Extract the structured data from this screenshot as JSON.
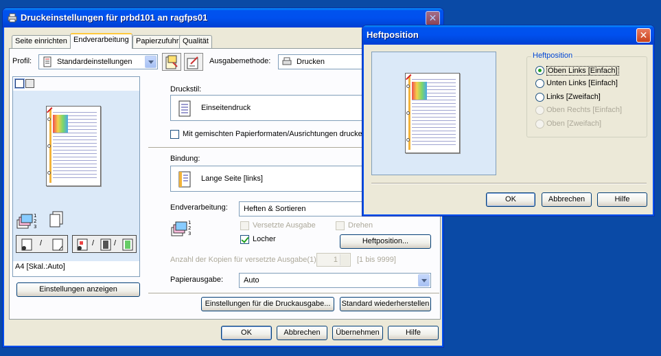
{
  "main_window": {
    "title": "Druckeinstellungen für prbd101 an ragfps01",
    "close_glyph": "✕",
    "tabs": [
      {
        "label": "Seite einrichten",
        "active": false
      },
      {
        "label": "Endverarbeitung",
        "active": true
      },
      {
        "label": "Papierzufuhr",
        "active": false
      },
      {
        "label": "Qualität",
        "active": false
      }
    ],
    "profile": {
      "label": "Profil:",
      "value": "Standardeinstellungen"
    },
    "output_method": {
      "label": "Ausgabemethode:",
      "value": "Drucken"
    },
    "preview": {
      "paper_label": "A4 [Skal.:Auto]",
      "show_settings_button": "Einstellungen anzeigen"
    },
    "print_style": {
      "label": "Druckstil:",
      "value": "Einseitendruck"
    },
    "mixed_formats": {
      "label": "Mit gemischten Papierformaten/Ausrichtungen drucken",
      "checked": false
    },
    "binding": {
      "label": "Bindung:",
      "value": "Lange Seite [links]"
    },
    "finishing": {
      "label": "Endverarbeitung:",
      "value": "Heften & Sortieren",
      "offset_output": {
        "label": "Versetzte Ausgabe",
        "checked": false,
        "enabled": false
      },
      "rotate": {
        "label": "Drehen",
        "checked": false,
        "enabled": false
      },
      "punch": {
        "label": "Locher",
        "checked": true,
        "enabled": true
      },
      "staple_position_button": "Heftposition..."
    },
    "offset_copies": {
      "label": "Anzahl der Kopien für versetzte Ausgabe(1):",
      "value": "1",
      "range": "[1 bis 9999]"
    },
    "paper_output": {
      "label": "Papierausgabe:",
      "value": "Auto"
    },
    "bottom_buttons": {
      "print_output_settings": "Einstellungen für die Druckausgabe...",
      "restore_defaults": "Standard wiederherstellen"
    },
    "dialog_buttons": {
      "ok": "OK",
      "cancel": "Abbrechen",
      "apply": "Übernehmen",
      "help": "Hilfe"
    }
  },
  "staple_dialog": {
    "title": "Heftposition",
    "close_glyph": "✕",
    "group_label": "Heftposition",
    "options": [
      {
        "label": "Oben Links [Einfach]",
        "selected": true,
        "enabled": true
      },
      {
        "label": "Unten Links [Einfach]",
        "selected": false,
        "enabled": true
      },
      {
        "label": "Links [Zweifach]",
        "selected": false,
        "enabled": true
      },
      {
        "label": "Oben Rechts [Einfach]",
        "selected": false,
        "enabled": false
      },
      {
        "label": "Oben [Zweifach]",
        "selected": false,
        "enabled": false
      }
    ],
    "buttons": {
      "ok": "OK",
      "cancel": "Abbrechen",
      "help": "Hilfe"
    }
  },
  "colors": {
    "desktop": "#0a4aa6",
    "titlebar": "#0050ee",
    "window_face": "#ece9d8",
    "preview_bg": "#dbe9f8",
    "close_red": "#c8421b"
  }
}
